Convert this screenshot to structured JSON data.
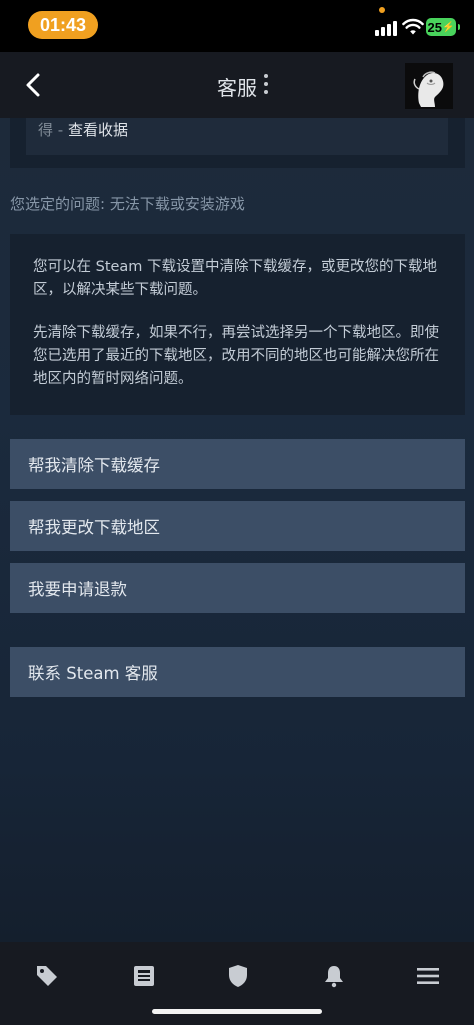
{
  "status_bar": {
    "time": "01:43",
    "battery": "25"
  },
  "header": {
    "title": "客服"
  },
  "previous_card": {
    "prefix": "得 - ",
    "link": "查看收据"
  },
  "selected_issue": "您选定的问题: 无法下载或安装游戏",
  "info": {
    "para1": "您可以在 Steam 下载设置中清除下载缓存，或更改您的下载地区，以解决某些下载问题。",
    "para2": "先清除下载缓存，如果不行，再尝试选择另一个下载地区。即使您已选用了最近的下载地区，改用不同的地区也可能解决您所在地区内的暂时网络问题。"
  },
  "actions": [
    {
      "label": "帮我清除下载缓存"
    },
    {
      "label": "帮我更改下载地区"
    },
    {
      "label": "我要申请退款"
    }
  ],
  "contact_button": {
    "label": "联系 Steam 客服"
  },
  "bottom_nav": {
    "icons": [
      "tag-icon",
      "news-icon",
      "shield-icon",
      "bell-icon",
      "menu-icon"
    ]
  },
  "colors": {
    "accent": "#f0a020",
    "button_bg": "#3c4e66",
    "header_bg": "#171a21"
  }
}
